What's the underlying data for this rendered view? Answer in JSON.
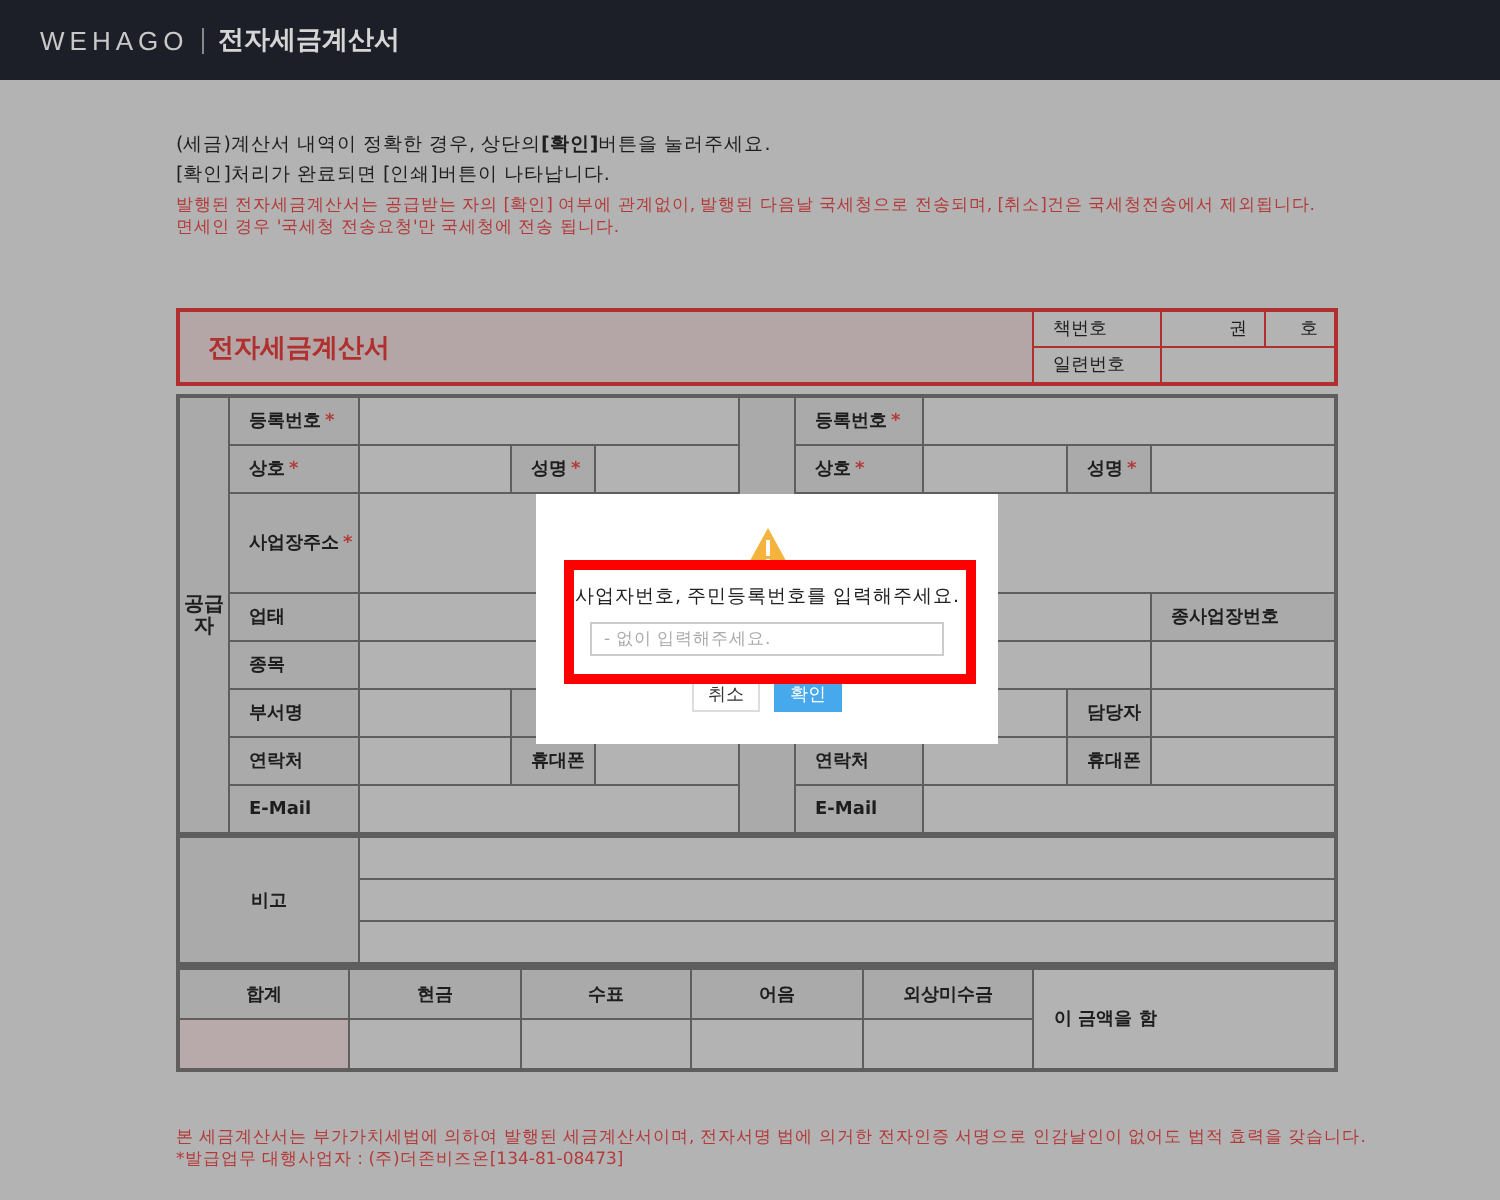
{
  "header": {
    "logo": "WEHAGO",
    "title": "전자세금계산서"
  },
  "notices": [
    {
      "text": "(세금)계산서 내역이 정확한 경우, 상단의**[확인]**버튼을 눌러주세요.",
      "color": "#1e1e1e"
    },
    {
      "text": "[확인]처리가 완료되면 [인쇄]버튼이 나타납니다.",
      "color": "#1e1e1e"
    },
    {
      "text": "발행된 전자세금계산서는 공급받는 자의 [확인] 여부에 관계없이, 발행된 다음날 국세청으로 전송되며, [취소]건은 국세청전송에서 제외됩니다.",
      "color": "#b43a3a"
    },
    {
      "text": "면세인 경우 '국세청 전송요청'만 국세청에 전송 됩니다.",
      "color": "#b43a3a"
    }
  ],
  "invoice": {
    "title": "전자세금계산서",
    "book_no_label": "책번호",
    "volume_label": "권",
    "number_label": "호",
    "serial_label": "일련번호",
    "supplier": {
      "side_label": "공급자",
      "registration_no": {
        "label": "등록번호",
        "mark": "*"
      },
      "company": {
        "label": "상호",
        "mark": "*"
      },
      "name": {
        "label": "성명",
        "mark": "*"
      },
      "address": {
        "label": "사업장주소",
        "mark": "*"
      },
      "business_type": {
        "label": "업태"
      },
      "item": {
        "label": "종목"
      },
      "department": {
        "label": "부서명"
      },
      "contact": {
        "label": "연락처"
      },
      "mobile": {
        "label": "휴대폰"
      },
      "email": {
        "label": "E-Mail"
      }
    },
    "recipient": {
      "registration_no": {
        "label": "등록번호",
        "mark": "*"
      },
      "company": {
        "label": "상호",
        "mark": "*"
      },
      "name": {
        "label": "성명",
        "mark": "*"
      },
      "sub_business_no": {
        "label": "종사업장번호"
      },
      "manager": {
        "label": "담당자"
      },
      "contact": {
        "label": "연락처"
      },
      "mobile": {
        "label": "휴대폰"
      },
      "email": {
        "label": "E-Mail"
      }
    },
    "remarks_label": "비고",
    "totals": {
      "columns": [
        "합계",
        "현금",
        "수표",
        "어음",
        "외상미수금"
      ],
      "statement": "이 금액을 함"
    }
  },
  "footer": [
    "본 세금계산서는 부가가치세법에 의하여 발행된 세금계산서이며, 전자서명 법에 의거한 전자인증 서명으로 인감날인이 없어도 법적 효력을 갖습니다.",
    "*발급업무 대행사업자 : (주)더존비즈온[134-81-08473]"
  ],
  "dialog": {
    "message": "사업자번호, 주민등록번호를 입력해주세요.",
    "input": {
      "placeholder": "- 없이 입력해주세요."
    },
    "buttons": [
      {
        "label": "취소",
        "kind": "secondary"
      },
      {
        "label": "확인",
        "kind": "primary"
      }
    ]
  }
}
